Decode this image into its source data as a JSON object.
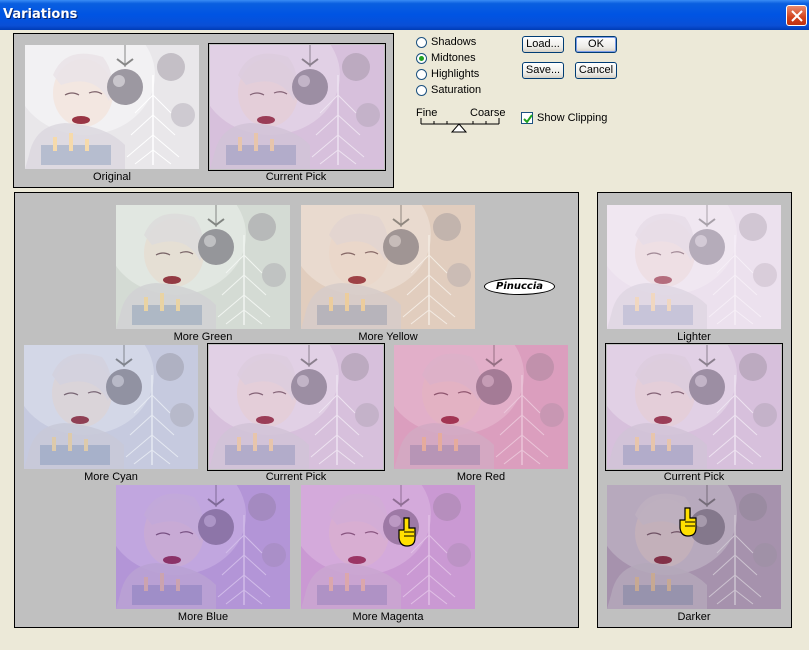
{
  "window": {
    "title": "Variations"
  },
  "preview": {
    "original_label": "Original",
    "current_pick_label": "Current Pick"
  },
  "modes": [
    {
      "label": "Shadows",
      "selected": false
    },
    {
      "label": "Midtones",
      "selected": true
    },
    {
      "label": "Highlights",
      "selected": false
    },
    {
      "label": "Saturation",
      "selected": false
    }
  ],
  "slider": {
    "fine_label": "Fine",
    "coarse_label": "Coarse"
  },
  "buttons": {
    "load": "Load...",
    "ok": "OK",
    "save": "Save...",
    "cancel": "Cancel"
  },
  "show_clipping": {
    "label": "Show Clipping",
    "checked": true
  },
  "variations": {
    "more_green": "More Green",
    "more_yellow": "More Yellow",
    "more_cyan": "More Cyan",
    "current_pick": "Current Pick",
    "more_red": "More Red",
    "more_blue": "More Blue",
    "more_magenta": "More Magenta"
  },
  "watermark": "Pinuccia",
  "brightness": {
    "lighter": "Lighter",
    "current_pick": "Current Pick",
    "darker": "Darker"
  },
  "colors": {
    "dialog_bg": "#ece9d8",
    "panel_bg": "#c0c0c0",
    "title_bar": "#0054e3",
    "radio_dot": "#21a121",
    "close_button": "#d2431c"
  },
  "icons": [
    "close-icon",
    "checkmark-icon",
    "pointing-hand-icon"
  ]
}
